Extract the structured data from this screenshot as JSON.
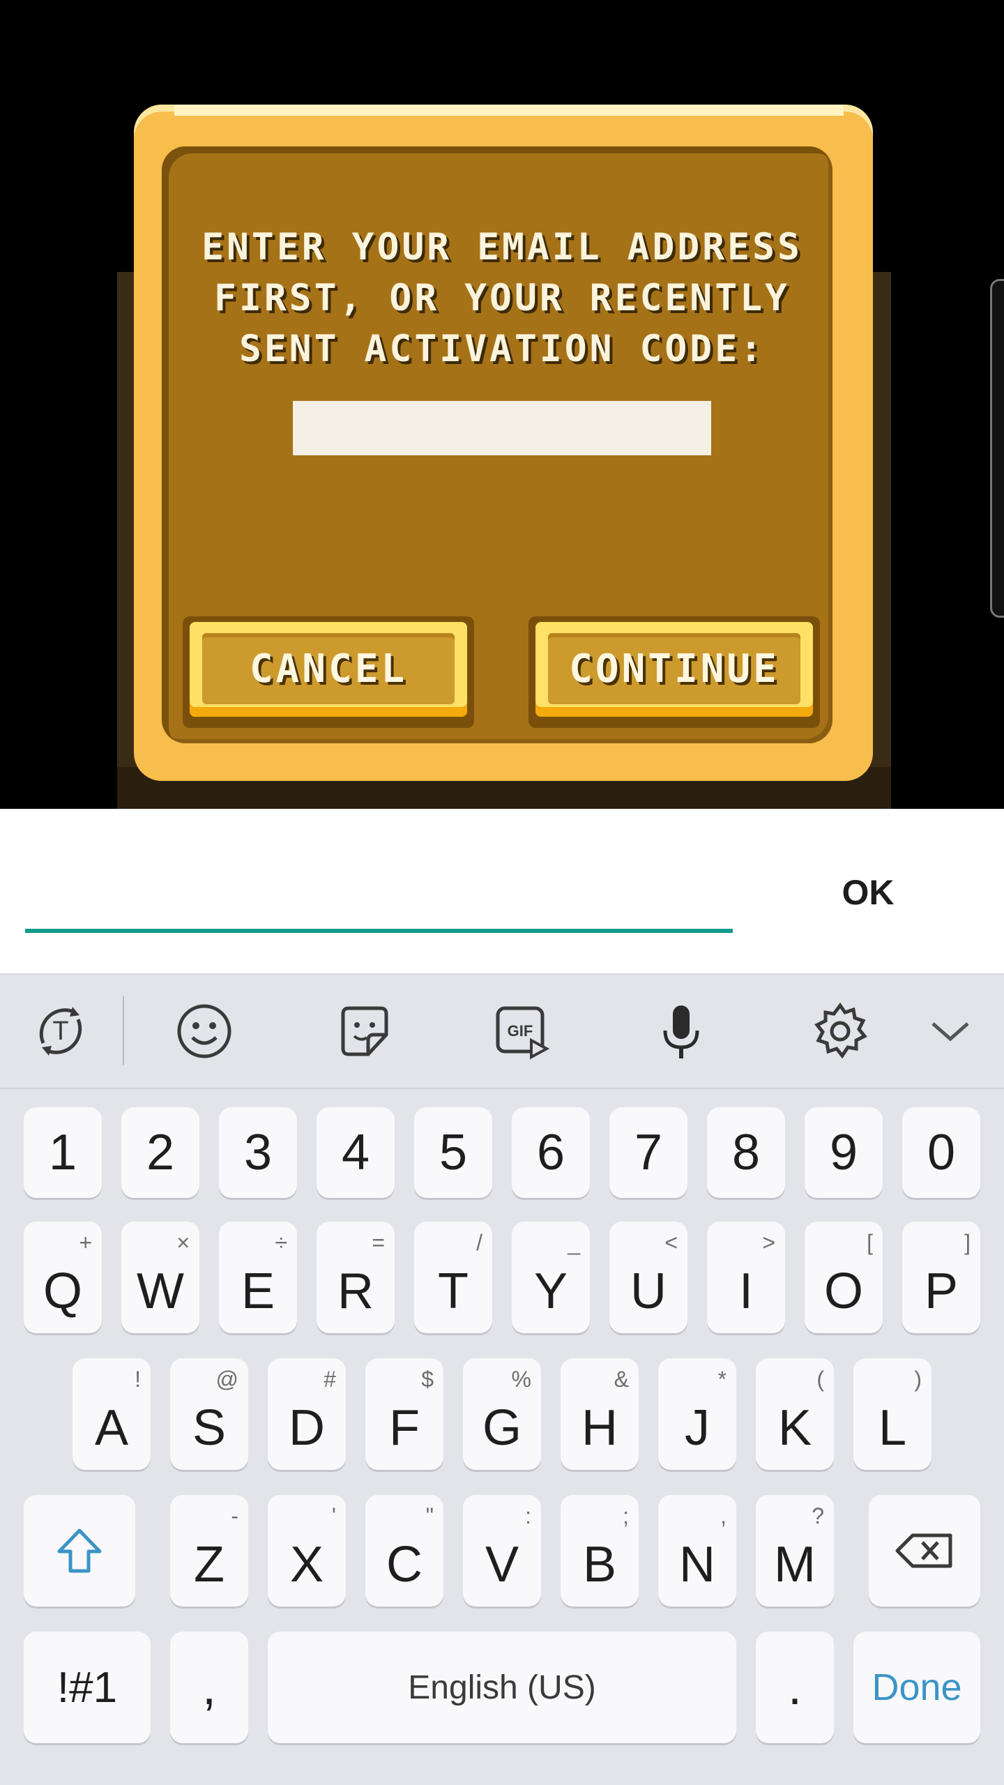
{
  "game": {
    "prompt": "ENTER YOUR EMAIL ADDRESS\nFIRST, OR YOUR RECENTLY\nSENT ACTIVATION CODE:",
    "cancel_label": "CANCEL",
    "continue_label": "CONTINUE"
  },
  "entry": {
    "ok_label": "OK",
    "value": "",
    "accent_color": "#139a8a"
  },
  "toolbar": {
    "icons": [
      "text-prediction-icon",
      "emoji-icon",
      "sticker-icon",
      "gif-icon",
      "microphone-icon",
      "settings-icon",
      "collapse-chevron-icon"
    ]
  },
  "keyboard": {
    "number_row": [
      "1",
      "2",
      "3",
      "4",
      "5",
      "6",
      "7",
      "8",
      "9",
      "0"
    ],
    "row1": [
      {
        "main": "Q",
        "sub": "+"
      },
      {
        "main": "W",
        "sub": "×"
      },
      {
        "main": "E",
        "sub": "÷"
      },
      {
        "main": "R",
        "sub": "="
      },
      {
        "main": "T",
        "sub": "/"
      },
      {
        "main": "Y",
        "sub": "_"
      },
      {
        "main": "U",
        "sub": "<"
      },
      {
        "main": "I",
        "sub": ">"
      },
      {
        "main": "O",
        "sub": "["
      },
      {
        "main": "P",
        "sub": "]"
      }
    ],
    "row2": [
      {
        "main": "A",
        "sub": "!"
      },
      {
        "main": "S",
        "sub": "@"
      },
      {
        "main": "D",
        "sub": "#"
      },
      {
        "main": "F",
        "sub": "$"
      },
      {
        "main": "G",
        "sub": "%"
      },
      {
        "main": "H",
        "sub": "&"
      },
      {
        "main": "J",
        "sub": "*"
      },
      {
        "main": "K",
        "sub": "("
      },
      {
        "main": "L",
        "sub": ")"
      }
    ],
    "row3": [
      {
        "main": "Z",
        "sub": "-"
      },
      {
        "main": "X",
        "sub": "'"
      },
      {
        "main": "C",
        "sub": "\""
      },
      {
        "main": "V",
        "sub": ":"
      },
      {
        "main": "B",
        "sub": ";"
      },
      {
        "main": "N",
        "sub": ","
      },
      {
        "main": "M",
        "sub": "?"
      }
    ],
    "symbols_label": "!#1",
    "comma_label": ",",
    "space_label": "English (US)",
    "period_label": ".",
    "done_label": "Done",
    "accent_color": "#3c94c6"
  }
}
